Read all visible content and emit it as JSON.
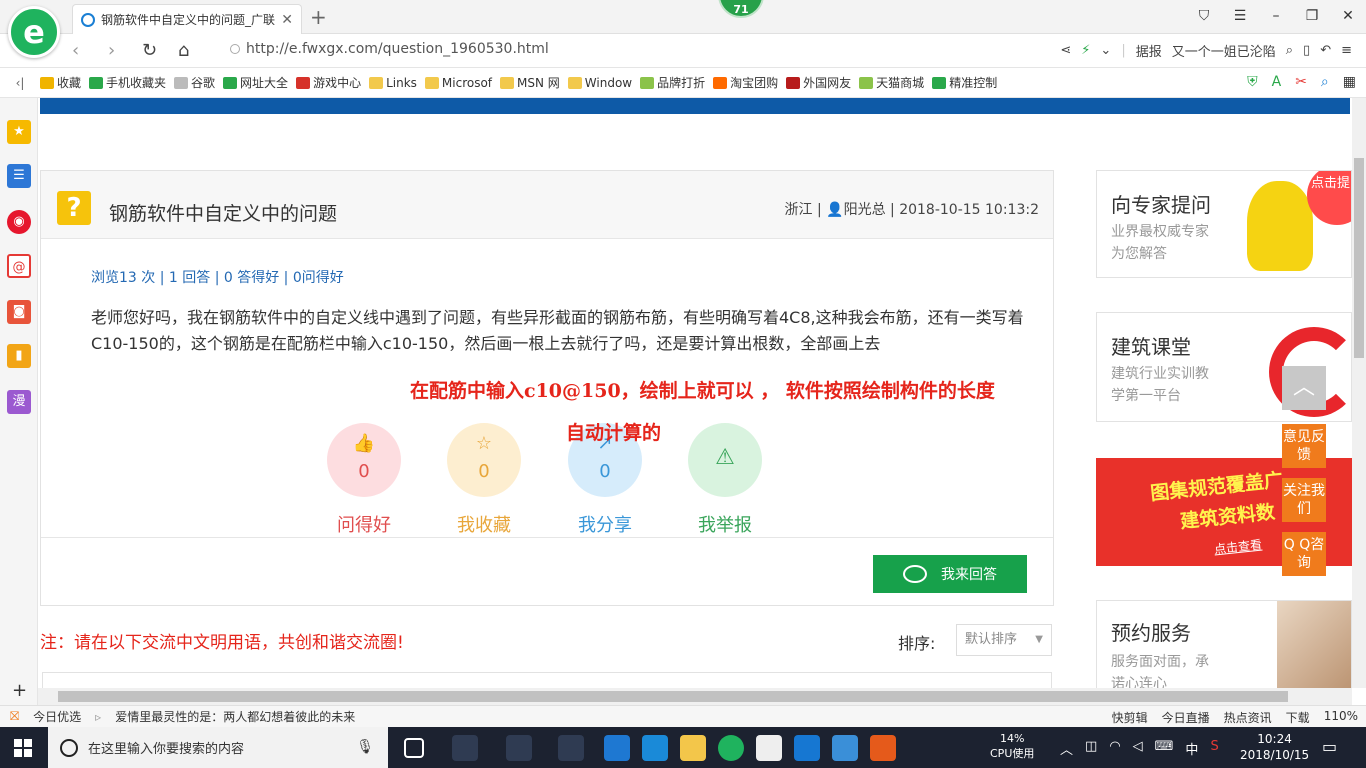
{
  "browser": {
    "tab_title": "钢筋软件中自定义中的问题_广联",
    "top_badge": "71",
    "url": "http://e.fwxgx.com/question_1960530.html",
    "report_label": "据报",
    "news_ticker": "又一个一姐已沦陷"
  },
  "bookmarks": [
    {
      "label": "收藏",
      "color": "#f0b400"
    },
    {
      "label": "手机收藏夹",
      "color": "#2aa84a"
    },
    {
      "label": "谷歌",
      "color": "#bbbbbb"
    },
    {
      "label": "网址大全",
      "color": "#2aa84a"
    },
    {
      "label": "游戏中心",
      "color": "#d6322a"
    },
    {
      "label": "Links",
      "color": "#f2c94c"
    },
    {
      "label": "Microsof",
      "color": "#f2c94c"
    },
    {
      "label": "MSN 网",
      "color": "#f2c94c"
    },
    {
      "label": "Window",
      "color": "#f2c94c"
    },
    {
      "label": "品牌打折",
      "color": "#8bc34a"
    },
    {
      "label": "淘宝团购",
      "color": "#ff6a00"
    },
    {
      "label": "外国网友",
      "color": "#b71c1c"
    },
    {
      "label": "天猫商城",
      "color": "#8bc34a"
    },
    {
      "label": "精准控制",
      "color": "#2aa84a"
    }
  ],
  "sidebar_icons": [
    "star-icon",
    "news-icon",
    "weibo-icon",
    "mail-icon",
    "game-icon",
    "book-icon",
    "comic-icon"
  ],
  "sidebar_comic_label": "漫",
  "question": {
    "title": "钢筋软件中自定义中的问题",
    "meta": "浙江 | 👤阳光总 | 2018-10-15 10:13:2",
    "stats": "浏览13 次 | 1 回答 | 0 答得好 | 0问得好",
    "body": "老师您好吗，我在钢筋软件中的自定义线中遇到了问题，有些异形截面的钢筋布筋，有些明确写着4C8,这种我会布筋，还有一类写着C10-150的，这个钢筋是在配筋栏中输入c10-150，然后画一根上去就行了吗，还是要计算出根数，全部画上去"
  },
  "answer_overlay": {
    "line1": "在配筋中输入c10@150，绘制上就可以 ，  软件按照绘制构件的长度",
    "line2": "自动计算的"
  },
  "actions": [
    {
      "label": "问得好",
      "count": "0",
      "color": "#e04e4e",
      "bg": "#fddde0",
      "icon": "thumb-up-icon",
      "glyph": "👍"
    },
    {
      "label": "我收藏",
      "count": "0",
      "color": "#e8a63a",
      "bg": "#fdeed0",
      "icon": "star-outline-icon",
      "glyph": "☆"
    },
    {
      "label": "我分享",
      "count": "0",
      "color": "#3a97d8",
      "bg": "#d6ecfb",
      "icon": "share-icon",
      "glyph": "↗"
    },
    {
      "label": "我举报",
      "count": "",
      "color": "#3aa55b",
      "bg": "#d9f3df",
      "icon": "warning-icon",
      "glyph": "⚠"
    }
  ],
  "answer_button": "我来回答",
  "notice": "注：请在以下交流中文明用语，共创和谐交流圈!",
  "sort": {
    "label": "排序:",
    "selected": "默认排序"
  },
  "right": {
    "expert": {
      "title": "向专家提问",
      "sub1": "业界最权威专家",
      "sub2": "为您解答",
      "bubble": "点击提问"
    },
    "course": {
      "title": "建筑课堂",
      "sub1": "建筑行业实训教",
      "sub2": "学第一平台"
    },
    "ad": {
      "t1": "图集规范覆盖广",
      "t2": "建筑资料数",
      "t3": "点击查看"
    },
    "service": {
      "title": "预约服务",
      "sub1": "服务面对面，承",
      "sub2": "诺心连心"
    }
  },
  "float": {
    "feedback": "意见反馈",
    "follow": "关注我们",
    "qq": "Q Q咨询"
  },
  "status": {
    "today": "今日优选",
    "headline": "爱情里最灵性的是：两人都幻想着彼此的未来",
    "items": [
      "快剪辑",
      "今日直播",
      "热点资讯",
      "下载"
    ],
    "zoom": "110%"
  },
  "taskbar": {
    "search_placeholder": "在这里输入你要搜索的内容",
    "cpu_percent": "14%",
    "cpu_label": "CPU使用",
    "ime": "中",
    "time": "10:24",
    "date": "2018/10/15"
  }
}
